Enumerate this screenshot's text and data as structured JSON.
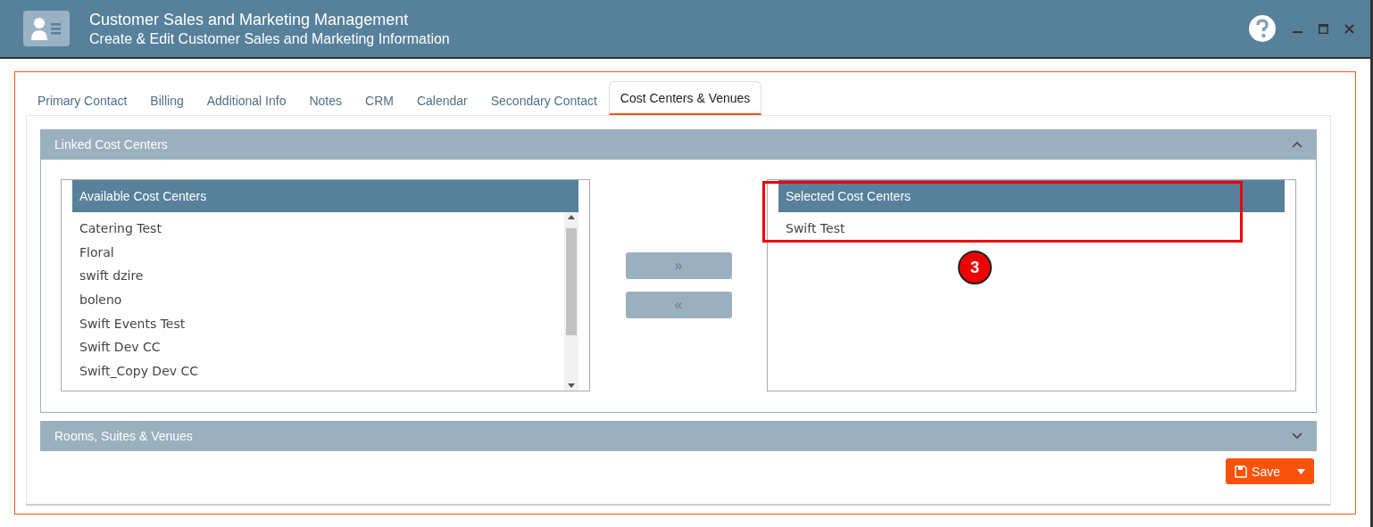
{
  "window": {
    "title": "Customer Sales and Marketing Management",
    "subtitle": "Create & Edit Customer Sales and Marketing Information"
  },
  "tabs": [
    {
      "label": "Primary Contact",
      "selected": false
    },
    {
      "label": "Billing",
      "selected": false
    },
    {
      "label": "Additional Info",
      "selected": false
    },
    {
      "label": "Notes",
      "selected": false
    },
    {
      "label": "CRM",
      "selected": false
    },
    {
      "label": "Calendar",
      "selected": false
    },
    {
      "label": "Secondary Contact",
      "selected": false
    },
    {
      "label": "Cost Centers & Venues",
      "selected": true
    }
  ],
  "sections": [
    {
      "title": "Linked Cost Centers",
      "expanded": true
    },
    {
      "title": "Rooms, Suites & Venues",
      "expanded": false
    }
  ],
  "available": {
    "title": "Available Cost Centers",
    "items": [
      "Catering Test",
      "Floral",
      "swift dzire",
      "boleno",
      "Swift Events Test",
      "Swift Dev CC",
      "Swift_Copy Dev CC"
    ]
  },
  "selected_list": {
    "title": "Selected Cost Centers",
    "items": [
      "Swift Test"
    ]
  },
  "move_buttons": [
    "»",
    "«"
  ],
  "annotation": {
    "number": "3"
  },
  "save_button": {
    "label": "Save"
  }
}
